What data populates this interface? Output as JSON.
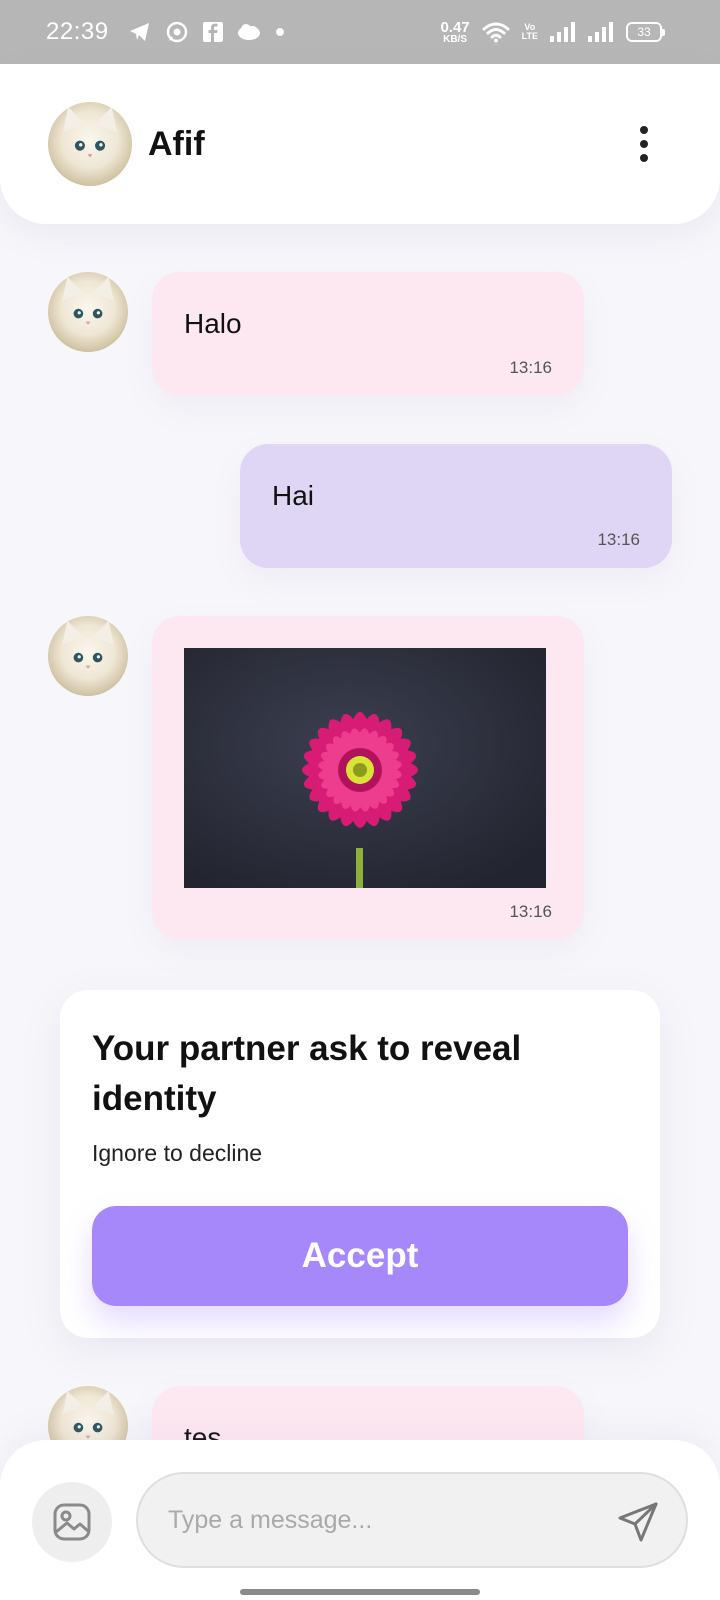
{
  "status_bar": {
    "time": "22:39",
    "left_icons": [
      "telegram-icon",
      "whatsapp-icon",
      "facebook-icon",
      "cloud-icon",
      "dot-icon"
    ],
    "net_speed_value": "0.47",
    "net_speed_unit": "KB/S",
    "volte_top": "Vo",
    "volte_bottom": "LTE",
    "battery": "33"
  },
  "header": {
    "name": "Afif",
    "avatar_icon": "cat-avatar",
    "menu_icon": "more-vertical-icon"
  },
  "messages": [
    {
      "direction": "incoming",
      "type": "text",
      "text": "Halo",
      "time": "13:16"
    },
    {
      "direction": "outgoing",
      "type": "text",
      "text": "Hai",
      "time": "13:16"
    },
    {
      "direction": "incoming",
      "type": "image",
      "image": "pink-gerbera-flower",
      "time": "13:16"
    },
    {
      "direction": "incoming",
      "type": "text",
      "text": "tes"
    }
  ],
  "reveal_request": {
    "title": "Your partner ask to reveal identity",
    "subtitle": "Ignore to decline",
    "accept_label": "Accept"
  },
  "composer": {
    "placeholder": "Type a message...",
    "attach_icon": "image-icon",
    "send_icon": "send-icon"
  },
  "colors": {
    "incoming_bubble": "#fde8f1",
    "outgoing_bubble": "#dfd6f5",
    "accent": "#a688fb",
    "status_bar": "#b6b6b6"
  }
}
